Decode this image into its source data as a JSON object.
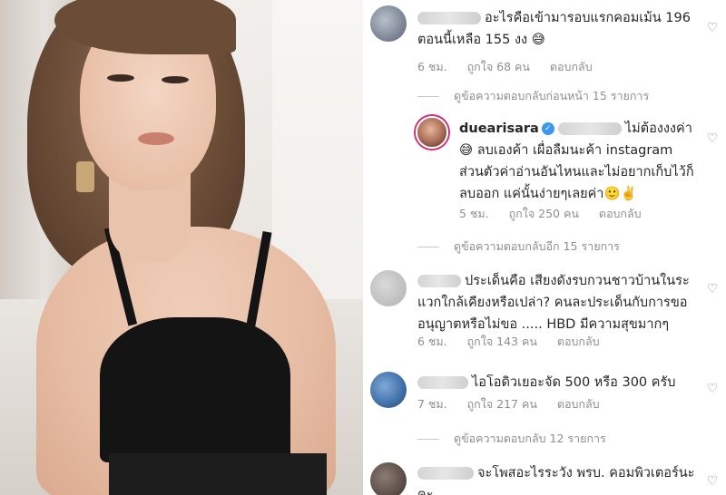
{
  "comments": [
    {
      "text": "อะไรคือเข้ามารอบแรกคอมเม้น 196 ตอนนี้เหลือ 155 งง 😅",
      "time": "6 ชม.",
      "likes": "ถูกใจ 68 คน",
      "reply": "ตอบกลับ"
    },
    {
      "view_replies": "ดูข้อความตอบกลับก่อนหน้า 15 รายการ"
    },
    {
      "username": "duearisara",
      "text": "ไม่ต้องงงค่า😅 ลบเองค้า เผื่อลืมนะค้า instagram ส่วนตัวค่าอ่านอันไหนและไม่อยากเก็บไว้ก็ลบออก แค่นั้นง่ายๆเลยค่า🙂✌️",
      "time": "5 ชม.",
      "likes": "ถูกใจ 250 คน",
      "reply": "ตอบกลับ"
    },
    {
      "view_replies": "ดูข้อความตอบกลับอีก 15 รายการ"
    },
    {
      "text": "ประเด็นคือ เสียงดังรบกวนชาวบ้านในระแวกใกล้เคียงหรือเปล่า? คนละประเด็นกับการขออนุญาตหรือไม่ขอ ..... HBD มีความสุขมากๆ",
      "time": "6 ชม.",
      "likes": "ถูกใจ 143 คน",
      "reply": "ตอบกลับ"
    },
    {
      "text": "ไอโอดิวเยอะจัด 500 หรือ 300 ครับ",
      "time": "7 ชม.",
      "likes": "ถูกใจ 217 คน",
      "reply": "ตอบกลับ"
    },
    {
      "view_replies": "ดูข้อความตอบกลับ 12 รายการ"
    },
    {
      "text": "จะโพสอะไรระวัง พรบ. คอมพิวเตอร์นะคะ"
    }
  ],
  "colors": {
    "text": "#262626",
    "meta": "#8e8e8e",
    "verified": "#3897f0",
    "story_ring": "#d62976"
  }
}
